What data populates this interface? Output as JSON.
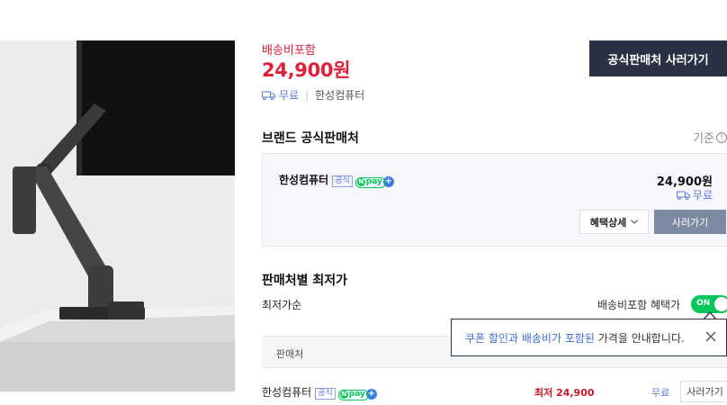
{
  "product": {
    "shipping_label": "배송비포함",
    "price": "24,900원",
    "shipping_free": "무료",
    "seller": "한성컴퓨터",
    "buy_button": "공식판매처 사러가기"
  },
  "brand_section": {
    "title": "브랜드 공식판매처",
    "criteria_label": "기준",
    "seller_name": "한성컴퓨터",
    "official_badge": "공식",
    "npay_label": "pay",
    "price": "24,900원",
    "shipping": "무료",
    "benefit_button": "혜택상세",
    "buy_button": "사러가기"
  },
  "lowest_section": {
    "title": "판매처별 최저가",
    "sort_label": "최저가순",
    "shipping_benefit_label": "배송비포함 혜택가",
    "toggle_state": "ON",
    "tooltip": {
      "highlight": "쿠폰 할인과 배송비가 포함된",
      "text": "가격을 안내합니다."
    },
    "table_header": "판매처",
    "rows": [
      {
        "seller": "한성컴퓨터",
        "official_badge": "공식",
        "npay_label": "pay",
        "price": "최저 24,900",
        "shipping": "무료",
        "buy": "사러가기"
      }
    ]
  },
  "colors": {
    "price_red": "#e1203b",
    "dark_button": "#2a3142",
    "accent_blue": "#5a7be0",
    "npay_green": "#03c75a"
  }
}
